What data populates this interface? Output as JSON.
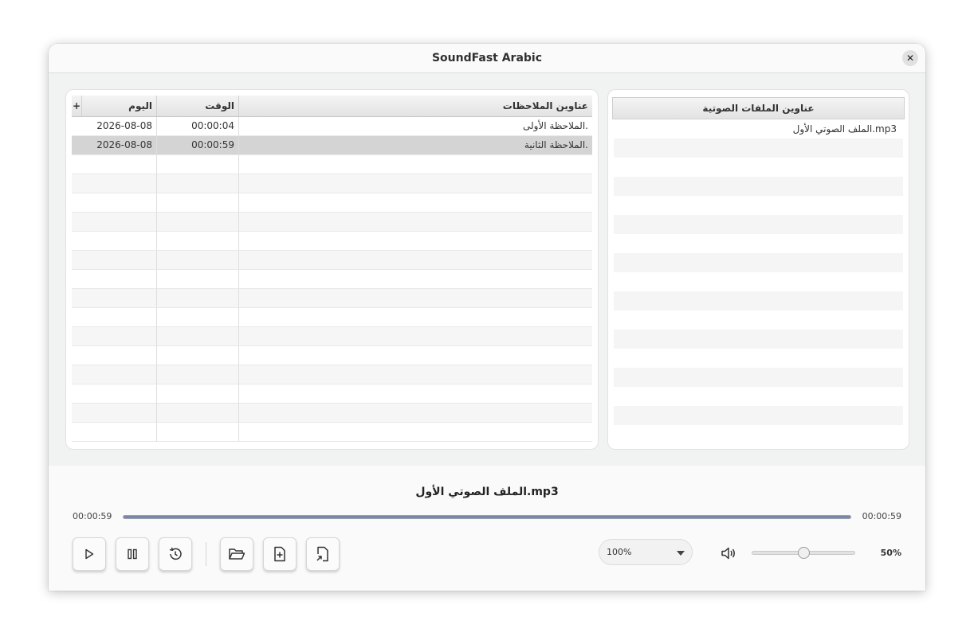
{
  "window": {
    "title": "SoundFast Arabic",
    "close_icon": "close-icon"
  },
  "notes_table": {
    "add_label": "+",
    "headers": {
      "day": "اليوم",
      "time": "الوقت",
      "title": "عناوين الملاحظات"
    },
    "rows": [
      {
        "day": "2026-08-08",
        "time": "00:00:04",
        "title": "الملاحظة  الأولى.",
        "selected": false
      },
      {
        "day": "2026-08-08",
        "time": "00:00:59",
        "title": "الملاحظة الثانية.",
        "selected": true
      }
    ],
    "empty_rows": 15
  },
  "audio_list": {
    "header": "عناوين الملفات الصوتية",
    "items": [
      "الملف الصوتي الأول.mp3"
    ],
    "empty_rows": 15
  },
  "player": {
    "now_playing": "الملف الصوتي الأول.mp3",
    "elapsed": "00:00:59",
    "duration": "00:00:59",
    "progress_fraction": 1.0,
    "buttons": {
      "play": "play-icon",
      "pause": "pause-icon",
      "replay": "history-icon",
      "open": "folder-open-icon",
      "new_note": "file-plus-icon",
      "export": "file-export-icon"
    },
    "speed": {
      "value": "100%"
    },
    "volume": {
      "icon": "speaker-icon",
      "percent_label": "50%",
      "level": 0.5
    }
  },
  "colors": {
    "progress": "#7b86a8",
    "selected_row": "#d4d4d4"
  }
}
